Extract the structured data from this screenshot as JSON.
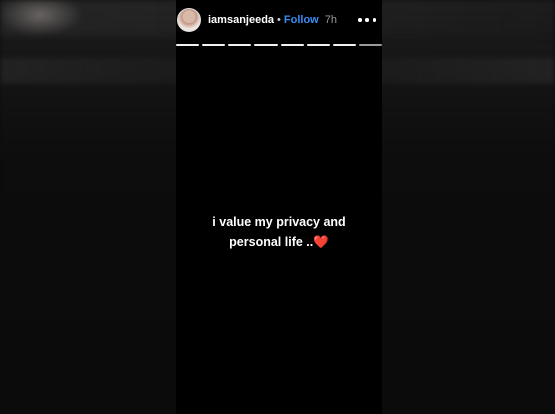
{
  "story": {
    "username": "iamsanjeeda",
    "separator": "•",
    "follow_label": "Follow",
    "time_ago": "7h",
    "progress_segments": 8,
    "caption_line1": "i value my privacy and",
    "caption_line2": "personal life ..",
    "heart_emoji": "❤️"
  },
  "icons": {
    "more": "more-options-icon",
    "avatar": "profile-avatar"
  },
  "colors": {
    "follow": "#3b8cf2",
    "heart": "#e0263a",
    "background": "#000000"
  }
}
